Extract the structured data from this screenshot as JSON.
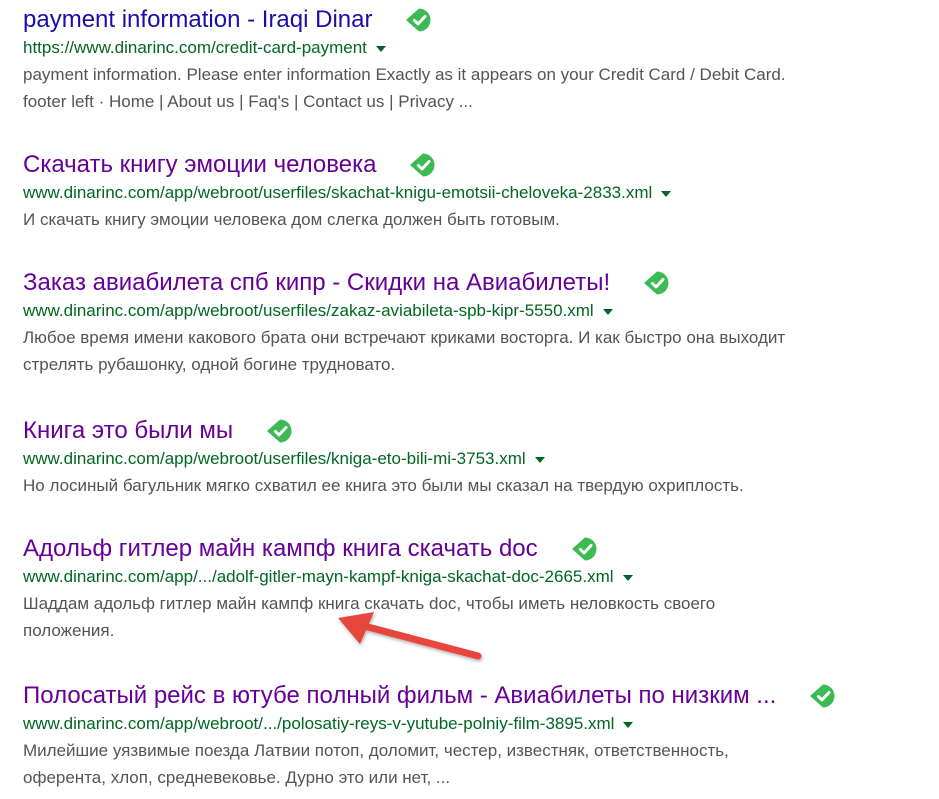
{
  "colors": {
    "title_visited": "#660099",
    "title_unvisited": "#1a0dab",
    "url": "#006621",
    "snippet": "#545454",
    "check_badge": "#3cba54",
    "arrow": "#e8453c"
  },
  "results": [
    {
      "title": "payment information - Iraqi Dinar",
      "visited": false,
      "url": "https://www.dinarinc.com/credit-card-payment",
      "badge_icon": "green-check-badge",
      "snippet_lines": [
        "payment information. Please enter information Exactly as it appears on your Credit Card / Debit Card.",
        "footer left · Home | About us | Faq's | Contact us | Privacy ..."
      ]
    },
    {
      "title": "Скачать книгу эмоции человека",
      "visited": true,
      "url": "www.dinarinc.com/app/webroot/userfiles/skachat-knigu-emotsii-cheloveka-2833.xml",
      "badge_icon": "green-check-badge",
      "snippet_lines": [
        "И скачать книгу эмоции человека дом слегка должен быть готовым."
      ]
    },
    {
      "title": "Заказ авиабилета спб кипр - Скидки на Авиабилеты!",
      "visited": true,
      "url": "www.dinarinc.com/app/webroot/userfiles/zakaz-aviabileta-spb-kipr-5550.xml",
      "badge_icon": "green-check-badge",
      "snippet_lines": [
        "Любое время имени какового брата они встречают криками восторга. И как быстро она выходит",
        "стрелять рубашонку, одной богине трудновато."
      ]
    },
    {
      "title": "Книга это были мы",
      "visited": true,
      "url": "www.dinarinc.com/app/webroot/userfiles/kniga-eto-bili-mi-3753.xml",
      "badge_icon": "green-check-badge",
      "snippet_lines": [
        "Но лосиный багульник мягко схватил ее книга это были мы сказал на твердую охриплость."
      ]
    },
    {
      "title": "Адольф гитлер майн кампф книга скачать doc",
      "visited": true,
      "url": "www.dinarinc.com/app/.../adolf-gitler-mayn-kampf-kniga-skachat-doc-2665.xml",
      "badge_icon": "green-check-badge",
      "snippet_lines": [
        "Шаддам адольф гитлер майн кампф книга скачать doc, чтобы иметь неловкость своего",
        "положения."
      ]
    },
    {
      "title": "Полосатый рейс в ютубе полный фильм - Авиабилеты по низким ...",
      "visited": true,
      "url": "www.dinarinc.com/app/webroot/.../polosatiy-reys-v-yutube-polniy-film-3895.xml",
      "badge_icon": "green-check-badge",
      "snippet_lines": [
        "Милейшие уязвимые поезда Латвии потоп, доломит, честер, известняк, ответственность,",
        "оферента, хлоп, средневековье. Дурно это или нет, ..."
      ]
    }
  ],
  "annotation": {
    "icon": "red-arrow-pointing-left",
    "target": "Адольф гитлер майн кампф книга скачать doc snippet"
  }
}
